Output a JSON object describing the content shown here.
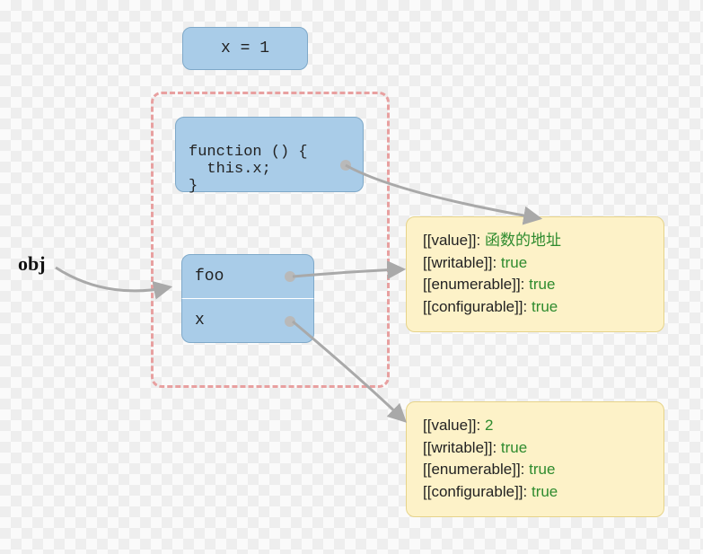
{
  "obj_label": "obj",
  "assignment": {
    "text": "x = 1"
  },
  "function_box": {
    "line1": "function () {",
    "line2": "  this.x;",
    "line3": "}"
  },
  "props": {
    "foo_label": "foo",
    "x_label": "x"
  },
  "descriptor_foo": {
    "value_key": "[[value]]: ",
    "value_val": "函数的地址",
    "writable_key": "[[writable]]: ",
    "writable_val": "true",
    "enumerable_key": "[[enumerable]]: ",
    "enumerable_val": "true",
    "configurable_key": "[[configurable]]: ",
    "configurable_val": "true"
  },
  "descriptor_x": {
    "value_key": "[[value]]: ",
    "value_val": "2",
    "writable_key": "[[writable]]: ",
    "writable_val": "true",
    "enumerable_key": "[[enumerable]]: ",
    "enumerable_val": "true",
    "configurable_key": "[[configurable]]: ",
    "configurable_val": "true"
  }
}
